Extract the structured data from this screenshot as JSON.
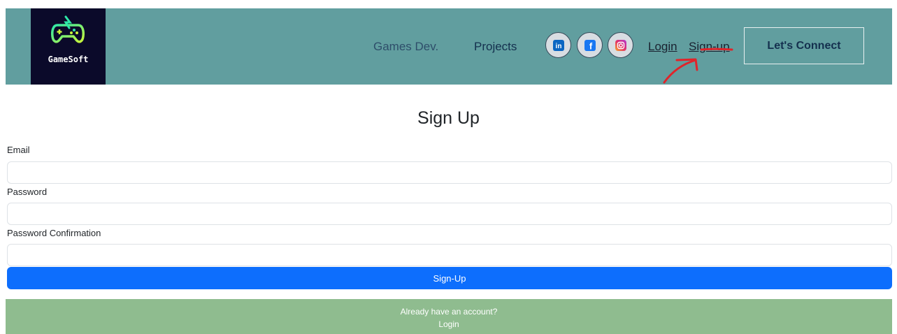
{
  "header": {
    "logo_text": "GameSoft",
    "nav": {
      "games": "Games Dev.",
      "projects": "Projects"
    },
    "social": [
      {
        "icon": "linkedin-icon",
        "glyph": "in",
        "color": "#0a66c2"
      },
      {
        "icon": "facebook-icon",
        "glyph": "f",
        "color": "#1877f2"
      },
      {
        "icon": "instagram-icon",
        "glyph": "◎",
        "color": "#e1306c"
      }
    ],
    "login": "Login",
    "signup": "Sign-up",
    "connect": "Let's Connect"
  },
  "form": {
    "title": "Sign Up",
    "email_label": "Email",
    "password_label": "Password",
    "confirm_label": "Password Confirmation",
    "email_value": "",
    "password_value": "",
    "confirm_value": "",
    "submit": "Sign-Up"
  },
  "footer": {
    "question": "Already have an account?",
    "login": "Login"
  },
  "colors": {
    "navbar": "#619e9f",
    "logo_bg": "#0b0a2a",
    "primary": "#0d6efd",
    "footer": "#8fbc8f",
    "annotation": "#e0242a"
  }
}
